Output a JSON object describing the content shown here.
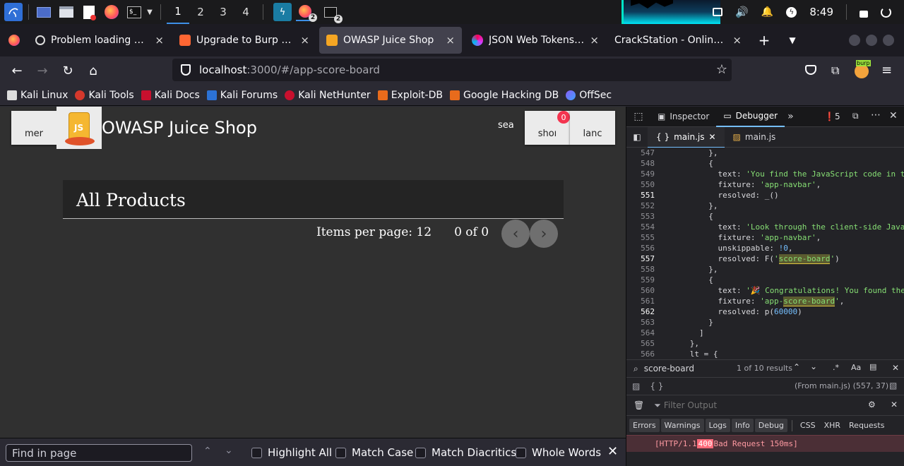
{
  "taskbar": {
    "workspaces": [
      "1",
      "2",
      "3",
      "4"
    ],
    "active_workspace": "1",
    "firefox_badge": "2",
    "terminal_badge": "2",
    "clock": "8:49"
  },
  "tabs": [
    {
      "label": "Problem loading page",
      "close": "×"
    },
    {
      "label": "Upgrade to Burp Suite Professional",
      "close": "×"
    },
    {
      "label": "OWASP Juice Shop",
      "close": "×",
      "active": true
    },
    {
      "label": "JSON Web Tokens - jwt.io",
      "close": "×"
    },
    {
      "label": "CrackStation - Online Password Hash Cracking",
      "close": "×"
    }
  ],
  "new_tab": "+",
  "url": {
    "host": "localhost",
    "path": ":3000/#/app-score-board"
  },
  "bookmarks": [
    "Kali Linux",
    "Kali Tools",
    "Kali Docs",
    "Kali Forums",
    "Kali NetHunter",
    "Exploit-DB",
    "Google Hacking DB",
    "OffSec"
  ],
  "page": {
    "menu_label": "mer",
    "title": "OWASP Juice Shop",
    "search_label": "sea",
    "cart_label": "shoı",
    "cart_count": "0",
    "lang_label": "lanc",
    "products_title": "All Products",
    "items_per_page": "Items per page: 12",
    "range": "0 of 0"
  },
  "findbar": {
    "placeholder": "Find in page",
    "highlight_all": "Highlight All",
    "match_case": "Match Case",
    "match_diacritics": "Match Diacritics",
    "whole_words": "Whole Words"
  },
  "devtools": {
    "tabs": [
      "Inspector",
      "Debugger"
    ],
    "error_count": "5",
    "files": [
      "main.js",
      "main.js"
    ],
    "lines": [
      "547",
      "548",
      "549",
      "550",
      "551",
      "552",
      "553",
      "554",
      "555",
      "556",
      "557",
      "558",
      "559",
      "560",
      "561",
      "562",
      "563",
      "564",
      "565",
      "566"
    ],
    "search_query": "score-board",
    "search_result": "1 of 10 results",
    "status_braces": "{ }",
    "status_location": "(From main.js)  (557, 37)",
    "filter_placeholder": "Filter Output",
    "console_tabs": [
      "Errors",
      "Warnings",
      "Logs",
      "Info",
      "Debug",
      "CSS",
      "XHR",
      "Requests"
    ],
    "console_msg_prefix": "[HTTP/1.1 ",
    "console_msg_code": "400",
    "console_msg_suffix": " Bad Request 150ms]"
  }
}
